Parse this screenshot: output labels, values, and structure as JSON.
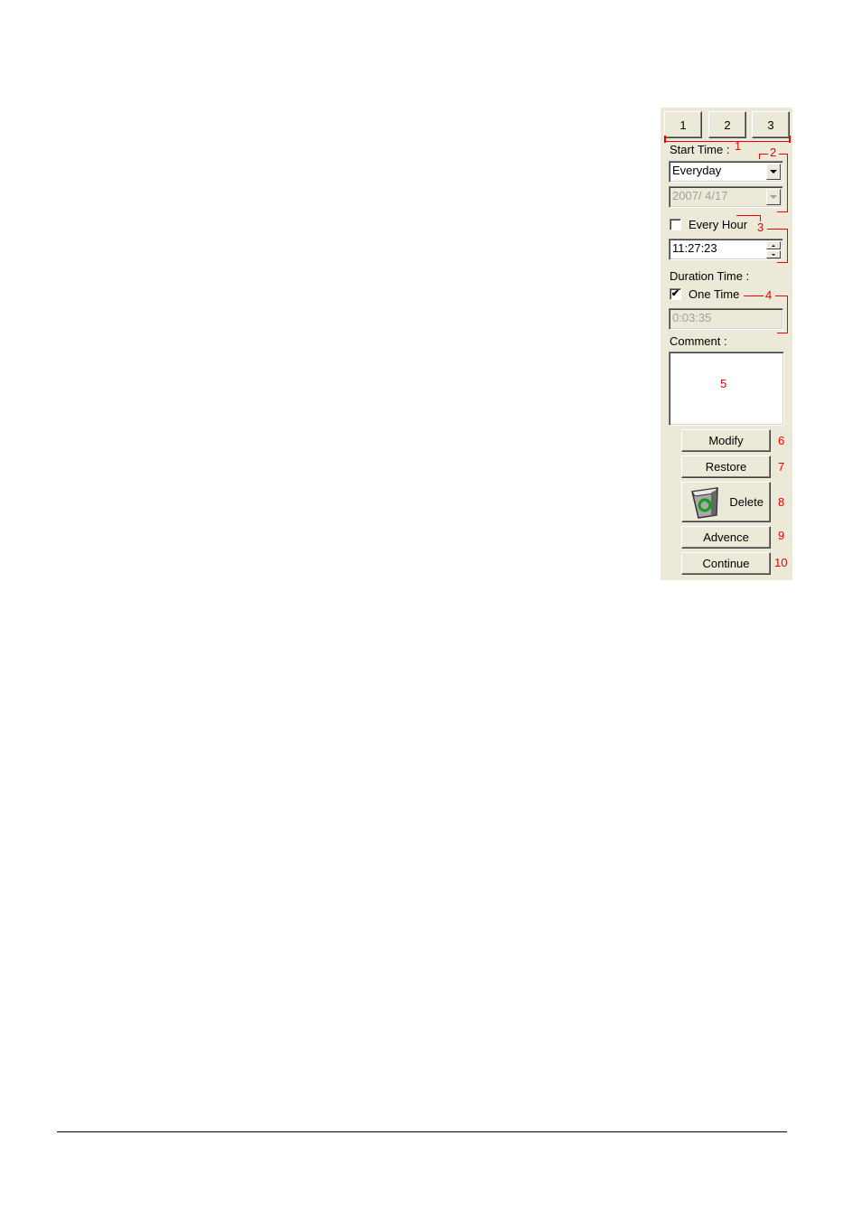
{
  "tabs": [
    {
      "label": "1"
    },
    {
      "label": "2"
    },
    {
      "label": "3"
    }
  ],
  "start_time": {
    "label": "Start Time :",
    "mode_select": {
      "value": "Everyday"
    },
    "date_select": {
      "value": "2007/  4/17",
      "disabled": true
    },
    "every_hour": {
      "label": "Every Hour",
      "checked": false
    },
    "time_input": {
      "value": "11:27:23"
    }
  },
  "duration_time": {
    "label": "Duration Time :",
    "one_time": {
      "label": "One Time",
      "checked": true,
      "check_glyph": "✔"
    },
    "duration_input": {
      "value": "0:03:35",
      "disabled": true
    }
  },
  "comment": {
    "label": "Comment :",
    "value": ""
  },
  "buttons": {
    "modify": "Modify",
    "restore": "Restore",
    "delete": "Delete",
    "advence": "Advence",
    "continue": "Continue"
  },
  "callouts": [
    "1",
    "2",
    "3",
    "4",
    "5",
    "6",
    "7",
    "8",
    "9",
    "10"
  ],
  "colors": {
    "panel_bg": "#ece9d8",
    "callout_red": "#ee0000"
  }
}
